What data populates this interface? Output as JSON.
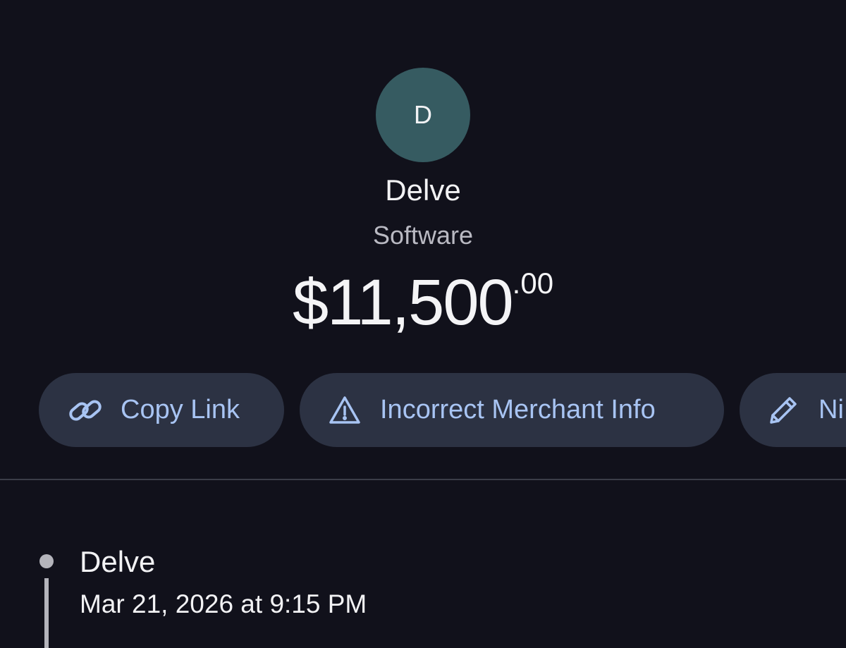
{
  "merchant": {
    "avatar_letter": "D",
    "avatar_color": "#365b61",
    "name": "Delve",
    "category": "Software"
  },
  "transaction": {
    "amount_whole": "$11,500",
    "amount_cents": ".00"
  },
  "actions": [
    {
      "label": "Copy Link",
      "icon": "link-icon"
    },
    {
      "label": "Incorrect Merchant Info",
      "icon": "warning-icon"
    },
    {
      "label": "Ni",
      "icon": "pencil-icon"
    }
  ],
  "timeline": [
    {
      "title": "Delve",
      "time": "Mar 21, 2026 at 9:15 PM"
    }
  ],
  "colors": {
    "background": "#11111b",
    "pill_background": "#2c3243",
    "accent": "#a8c4f3"
  }
}
